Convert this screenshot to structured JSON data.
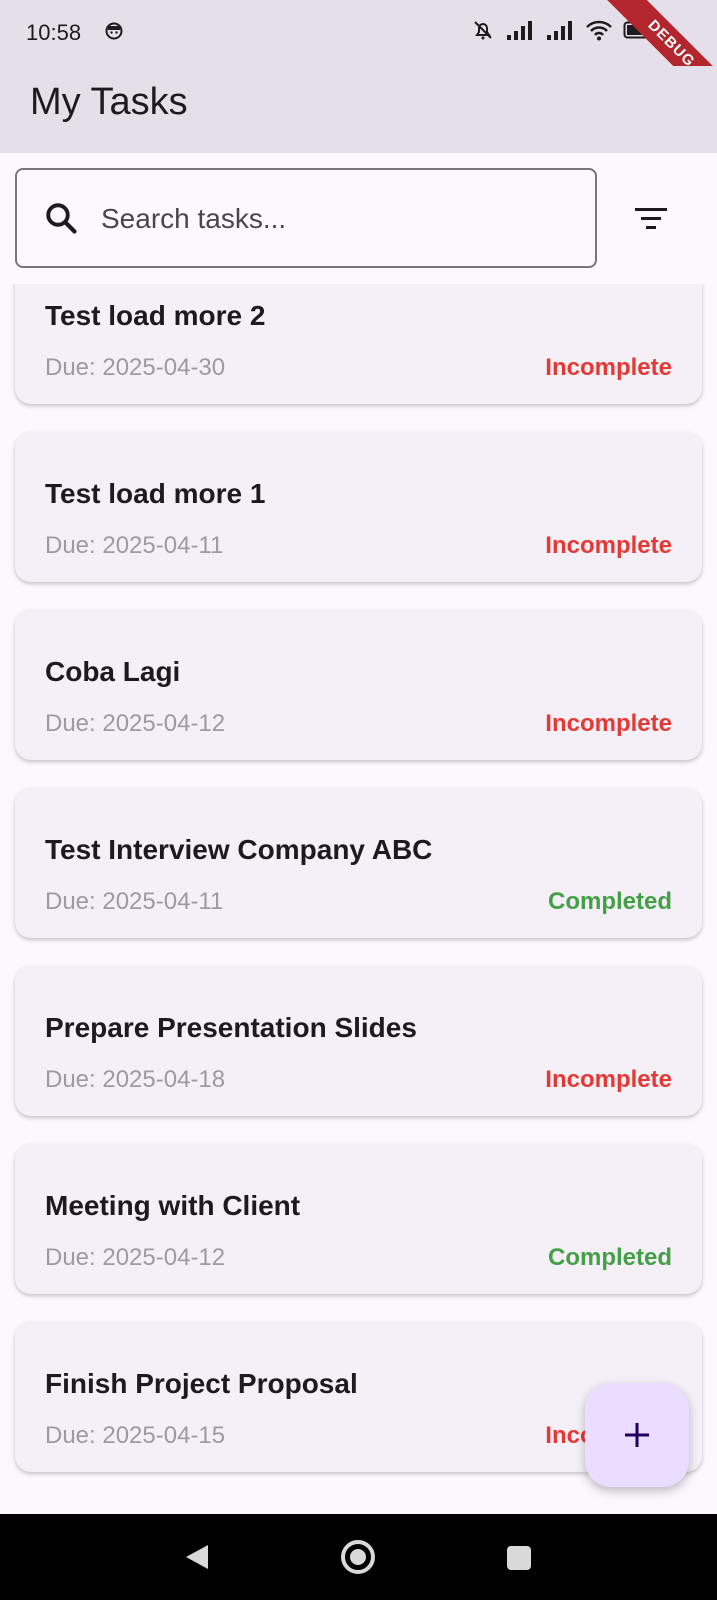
{
  "status_bar": {
    "time": "10:58",
    "debug_label": "DEBUG"
  },
  "app_bar": {
    "title": "My Tasks"
  },
  "search": {
    "placeholder": "Search tasks...",
    "value": ""
  },
  "icons": {
    "search": "search-icon",
    "filter": "filter-icon",
    "add": "add-icon",
    "back": "back-icon",
    "home": "home-icon",
    "recents": "recents-icon"
  },
  "colors": {
    "incomplete": "#e53935",
    "completed": "#43a047",
    "fab": "#eaddff",
    "app_bar": "#e5dfe9"
  },
  "tasks": [
    {
      "title": "Test load more 2",
      "due": "Due: 2025-04-30",
      "status": "Incomplete"
    },
    {
      "title": "Test load more 1",
      "due": "Due: 2025-04-11",
      "status": "Incomplete"
    },
    {
      "title": "Coba Lagi",
      "due": "Due: 2025-04-12",
      "status": "Incomplete"
    },
    {
      "title": "Test Interview Company ABC",
      "due": "Due: 2025-04-11",
      "status": "Completed"
    },
    {
      "title": "Prepare Presentation Slides",
      "due": "Due: 2025-04-18",
      "status": "Incomplete"
    },
    {
      "title": "Meeting with Client",
      "due": "Due: 2025-04-12",
      "status": "Completed"
    },
    {
      "title": "Finish Project Proposal",
      "due": "Due: 2025-04-15",
      "status": "Incomplete"
    }
  ]
}
